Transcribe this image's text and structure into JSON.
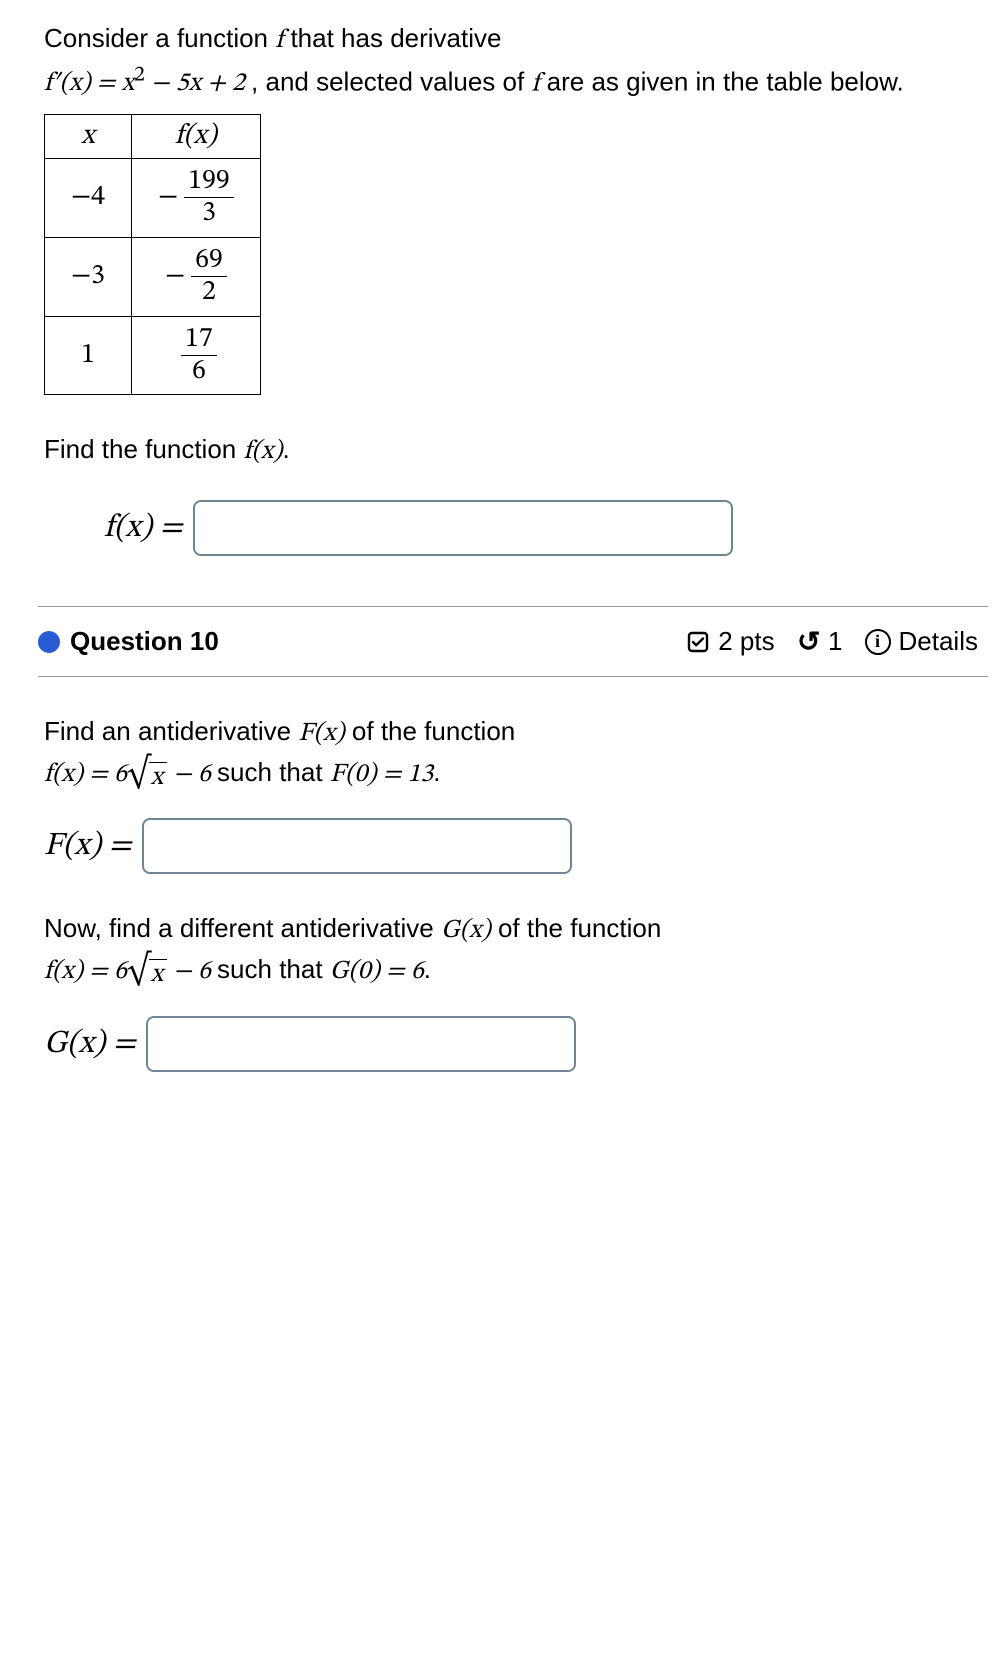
{
  "q9": {
    "intro_part1": "Consider a function ",
    "intro_f": "f",
    "intro_part2": "  that has derivative",
    "deriv_lhs": "f′(x) = x",
    "deriv_sup": "2",
    "deriv_rhs": " − 5x + 2",
    "intro_part3": ", and selected values of ",
    "intro_f2": "f",
    "intro_part4": " are as given in the table below.",
    "table": {
      "hx": "x",
      "hfx": "f(x)",
      "rows": [
        {
          "x": "−4",
          "neg": "−",
          "num": "199",
          "den": "3"
        },
        {
          "x": "−3",
          "neg": "−",
          "num": "69",
          "den": "2"
        },
        {
          "x": "1",
          "neg": "",
          "num": "17",
          "den": "6"
        }
      ]
    },
    "find_text_1": "Find the function ",
    "find_math": "f(x)",
    "find_text_2": ".",
    "answer_label": "f(x) ="
  },
  "q10": {
    "header": {
      "label": "Question 10",
      "pts": "2 pts",
      "retries": "1",
      "details": "Details"
    },
    "p1a": "Find an antiderivative ",
    "p1_F": "F(x)",
    "p1b": " of the function",
    "p1_eq_lhs": "f(x) = 6",
    "p1_radicand": "x",
    "p1_eq_rhs": " − 6",
    "p1c": " such that ",
    "p1_cond": "F(0) = 13",
    "p1d": ".",
    "ans1_label": "F(x) =",
    "p2a": "Now, find a different antiderivative ",
    "p2_G": "G(x)",
    "p2b": " of the function",
    "p2_eq_lhs": "f(x) = 6",
    "p2_radicand": "x",
    "p2_eq_rhs": " − 6",
    "p2c": " such that ",
    "p2_cond": "G(0) = 6",
    "p2d": ".",
    "ans2_label": "G(x) ="
  }
}
